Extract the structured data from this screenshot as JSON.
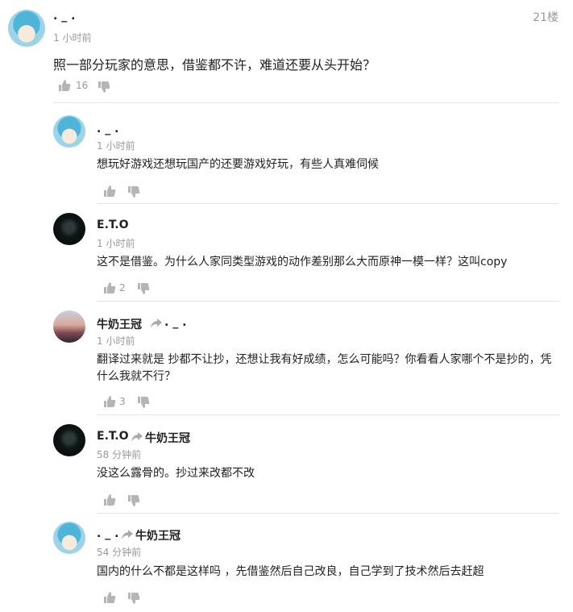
{
  "main_comment": {
    "username": ". _ .",
    "time": "1 小时前",
    "floor": "21楼",
    "text": "照一部分玩家的意思，借鉴都不许，难道还要从头开始？",
    "likes": "16"
  },
  "replies": [
    {
      "username": ". _ .",
      "reply_to": "",
      "time": "1 小时前",
      "text": "想玩好游戏还想玩国产的还要游戏好玩，有些人真难伺候",
      "likes": ""
    },
    {
      "username": "E.T.O",
      "reply_to": "",
      "time": "1 小时前",
      "text": "这不是借鉴。为什么人家同类型游戏的动作差别那么大而原神一模一样？这叫copy",
      "likes": "2"
    },
    {
      "username": "牛奶王冠",
      "reply_to": ". _ .",
      "time": "1 小时前",
      "text_line1": "翻译过来就是 抄都不让抄，还想让我有好成绩，怎么可能吗？你看看人家哪个不是抄的，凭",
      "text_line2": "什么我就不行？",
      "likes": "3"
    },
    {
      "username": "E.T.O",
      "reply_to": "牛奶王冠",
      "time": "58 分钟前",
      "text": "没这么露骨的。抄过来改都不改",
      "likes": ""
    },
    {
      "username": ". _ .",
      "reply_to": "牛奶王冠",
      "time": "54 分钟前",
      "text": "国内的什么不都是这样吗 ，先借鉴然后自己改良，自己学到了技术然后去赶超",
      "likes": ""
    }
  ],
  "icons": {
    "like": "thumbs-up-icon",
    "dislike": "thumbs-down-icon",
    "reply_arrow": "reply-arrow-icon"
  },
  "colors": {
    "text": "#222222",
    "muted": "#999999",
    "icon": "#b5b5b5",
    "divider": "#e6e6e6"
  }
}
